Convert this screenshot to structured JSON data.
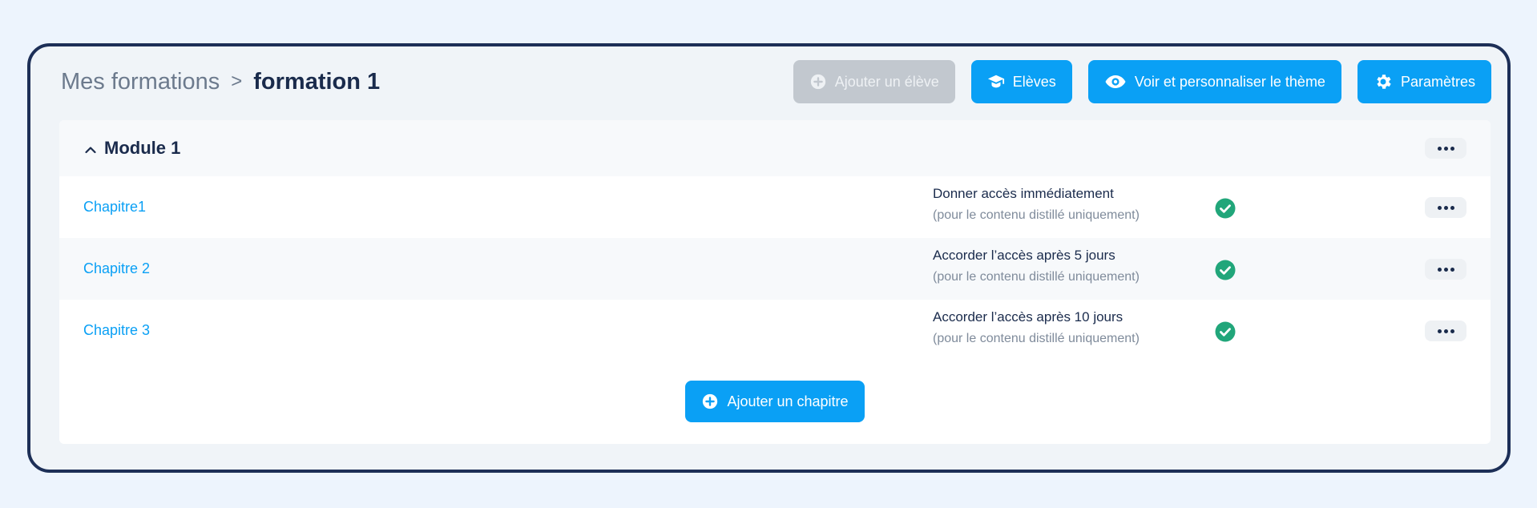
{
  "breadcrumb": {
    "parent": "Mes formations",
    "separator": ">",
    "current": "formation 1"
  },
  "toolbar": {
    "add_student_label": "Ajouter un élève",
    "students_label": "Elèves",
    "theme_label": "Voir et personnaliser le thème",
    "settings_label": "Paramètres"
  },
  "module": {
    "title": "Module 1",
    "chapters": [
      {
        "name": "Chapitre1",
        "access": "Donner accès immédiatement",
        "note": "(pour le contenu distillé uniquement)"
      },
      {
        "name": "Chapitre 2",
        "access": "Accorder l’accès après 5 jours",
        "note": "(pour le contenu distillé uniquement)"
      },
      {
        "name": "Chapitre 3",
        "access": "Accorder l’accès après 10 jours",
        "note": "(pour le contenu distillé uniquement)"
      }
    ],
    "add_chapter_label": "Ajouter un chapitre"
  },
  "icons": {
    "add": "plus-circle-icon",
    "students": "graduation-cap-icon",
    "theme": "eye-icon",
    "settings": "gear-icon",
    "collapse": "chevron-up-icon",
    "more": "more-horizontal-icon",
    "status": "check-circle-icon"
  },
  "colors": {
    "primary": "#0aa0f5",
    "disabled": "#c2c8cf",
    "success": "#21a67a",
    "frame_border": "#1d2f57"
  }
}
